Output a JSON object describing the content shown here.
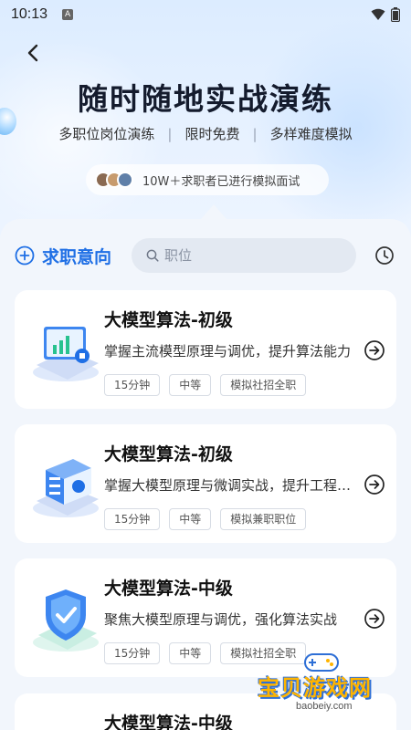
{
  "status_bar": {
    "time": "10:13",
    "notif_badge": "A"
  },
  "hero": {
    "title": "随时随地实战演练",
    "subtitle_items": [
      "多职位岗位演练",
      "限时免费",
      "多样难度模拟"
    ],
    "social_proof": "10W＋求职者已进行模拟面试"
  },
  "filters": {
    "intent_label": "求职意向",
    "search_placeholder": "职位"
  },
  "cards": [
    {
      "title": "大模型算法-初级",
      "desc": "掌握主流模型原理与调优，提升算法能力",
      "tags": [
        "15分钟",
        "中等",
        "模拟社招全职"
      ],
      "icon": "laptop-chart-icon"
    },
    {
      "title": "大模型算法-初级",
      "desc": "掌握大模型原理与微调实战，提升工程能力",
      "tags": [
        "15分钟",
        "中等",
        "模拟兼职职位"
      ],
      "icon": "server-rack-icon"
    },
    {
      "title": "大模型算法-中级",
      "desc": "聚焦大模型原理与调优，强化算法实战",
      "tags": [
        "15分钟",
        "中等",
        "模拟社招全职"
      ],
      "icon": "shield-check-icon"
    },
    {
      "title": "大模型算法-中级"
    }
  ],
  "watermark": {
    "text": "宝贝游戏网",
    "url": "baobeiy.com"
  },
  "colors": {
    "accent": "#1f6fe5",
    "panel_bg": "#f2f6fc",
    "hero_bg": "#dcecff"
  }
}
